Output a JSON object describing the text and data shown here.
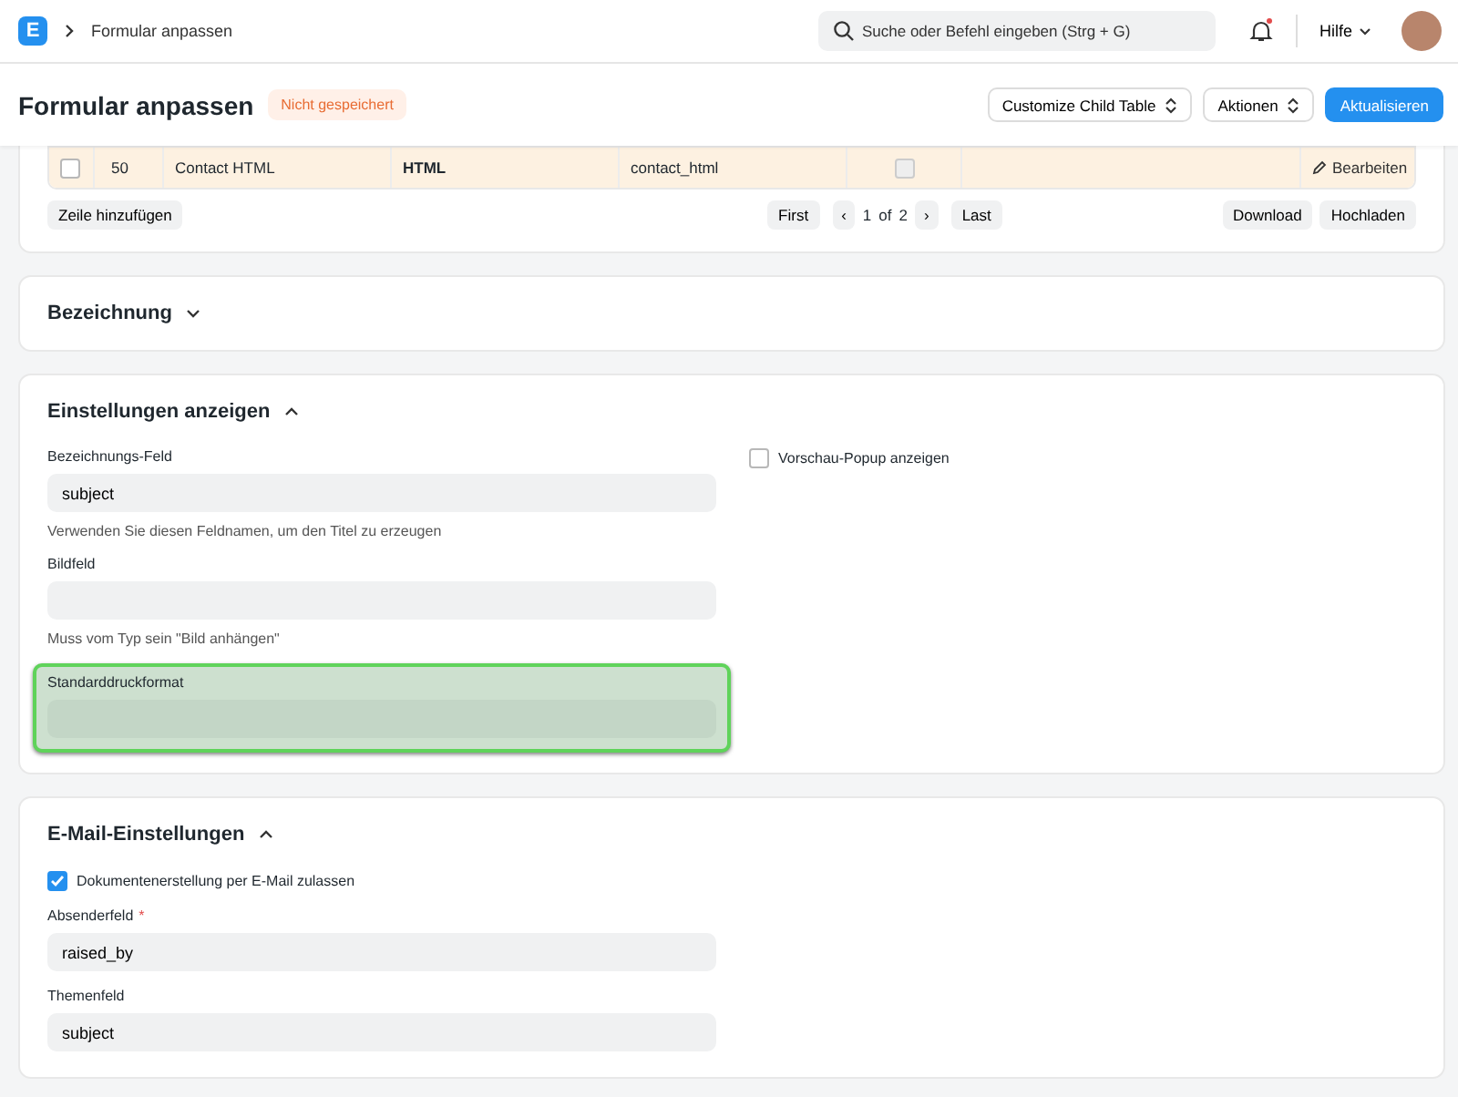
{
  "navbar": {
    "logo": "E",
    "breadcrumb": "Formular anpassen",
    "search": {
      "placeholder": "Suche oder Befehl eingeben (Strg + G)"
    },
    "notifications_unread": true,
    "help": "Hilfe"
  },
  "page_header": {
    "title": "Formular anpassen",
    "status": "Nicht gespeichert",
    "buttons": [
      {
        "label": "Customize Child Table",
        "kind": "dropdown"
      },
      {
        "label": "Aktionen",
        "kind": "dropdown"
      },
      {
        "label": "Aktualisieren",
        "kind": "primary"
      }
    ]
  },
  "fields_table": {
    "rows": [
      {
        "number": "50",
        "label": "Contact HTML",
        "type": "HTML",
        "fieldname": "contact_html",
        "checked": false,
        "selected": false,
        "edit": "Bearbeiten"
      }
    ],
    "add_row": "Zeile hinzufügen",
    "pagination": {
      "first": "First",
      "prev": "‹",
      "page": "1",
      "of": "of",
      "total": "2",
      "next": "›",
      "last": "Last"
    },
    "download": "Download",
    "upload": "Hochladen"
  },
  "sections": [
    {
      "title": "Bezeichnung",
      "expanded": false
    },
    {
      "title": "Einstellungen anzeigen",
      "expanded": true,
      "fields": [
        {
          "kind": "input",
          "label": "Bezeichnungs-Feld",
          "value": "subject",
          "description": "Verwenden Sie diesen Feldnamen, um den Titel zu erzeugen"
        },
        {
          "kind": "input",
          "label": "Bildfeld",
          "description": "Muss vom Typ sein \"Bild anhängen\""
        },
        {
          "kind": "input",
          "label": "Standarddruckformat",
          "highlighted": true
        }
      ],
      "side_fields": [
        {
          "kind": "checkbox",
          "label": "Vorschau-Popup anzeigen",
          "checked": false
        }
      ]
    },
    {
      "title": "E-Mail-Einstellungen",
      "expanded": true,
      "fields": [
        {
          "kind": "checkbox",
          "label": "Dokumentenerstellung per E-Mail zulassen",
          "checked": true
        },
        {
          "kind": "input",
          "label": "Absenderfeld",
          "required_mark": "*",
          "value": "raised_by"
        },
        {
          "kind": "input",
          "label": "Themenfeld",
          "value": "subject"
        }
      ]
    }
  ]
}
